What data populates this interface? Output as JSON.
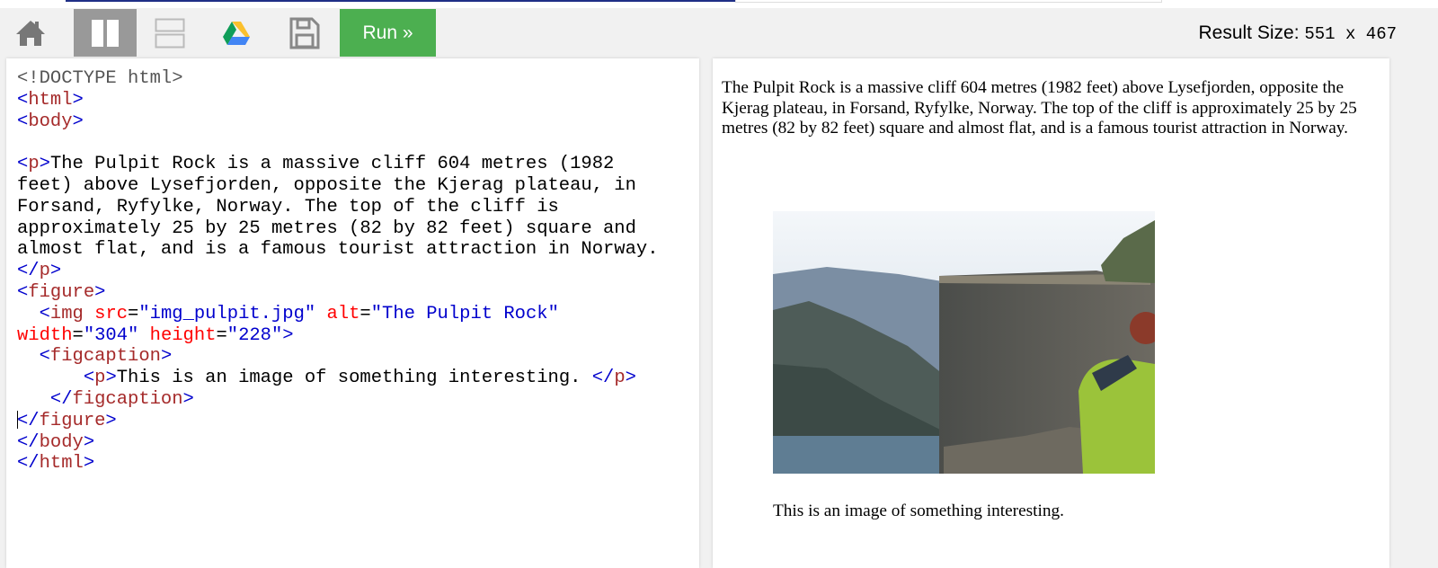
{
  "toolbar": {
    "icons": [
      "home-icon",
      "side-by-side-layout-icon",
      "stacked-layout-icon",
      "google-drive-icon",
      "save-icon"
    ],
    "run_label": "Run »",
    "result_size_label": "Result Size:",
    "result_size_value": "551 x 467"
  },
  "editor": {
    "lines": [
      [
        [
          "doc",
          "<!DOCTYPE html>"
        ]
      ],
      [
        [
          "br",
          "<"
        ],
        [
          "tag",
          "html"
        ],
        [
          "br",
          ">"
        ]
      ],
      [
        [
          "br",
          "<"
        ],
        [
          "tag",
          "body"
        ],
        [
          "br",
          ">"
        ]
      ],
      [],
      [
        [
          "br",
          "<"
        ],
        [
          "tag",
          "p"
        ],
        [
          "br",
          ">"
        ],
        [
          "txt",
          "The Pulpit Rock is a massive cliff 604 metres (1982"
        ]
      ],
      [
        [
          "txt",
          "feet) above Lysefjorden, opposite the Kjerag plateau, in"
        ]
      ],
      [
        [
          "txt",
          "Forsand, Ryfylke, Norway. The top of the cliff is"
        ]
      ],
      [
        [
          "txt",
          "approximately 25 by 25 metres (82 by 82 feet) square and"
        ]
      ],
      [
        [
          "txt",
          "almost flat, and is a famous tourist attraction in Norway."
        ]
      ],
      [
        [
          "br",
          "</"
        ],
        [
          "tag",
          "p"
        ],
        [
          "br",
          ">"
        ]
      ],
      [
        [
          "br",
          "<"
        ],
        [
          "tag",
          "figure"
        ],
        [
          "br",
          ">"
        ]
      ],
      [
        [
          "txt",
          "  "
        ],
        [
          "br",
          "<"
        ],
        [
          "tag",
          "img"
        ],
        [
          "txt",
          " "
        ],
        [
          "attr",
          "src"
        ],
        [
          "txt",
          "="
        ],
        [
          "val",
          "\"img_pulpit.jpg\""
        ],
        [
          "txt",
          " "
        ],
        [
          "attr",
          "alt"
        ],
        [
          "txt",
          "="
        ],
        [
          "val",
          "\"The Pulpit Rock\""
        ]
      ],
      [
        [
          "attr",
          "width"
        ],
        [
          "txt",
          "="
        ],
        [
          "val",
          "\"304\""
        ],
        [
          "txt",
          " "
        ],
        [
          "attr",
          "height"
        ],
        [
          "txt",
          "="
        ],
        [
          "val",
          "\"228\""
        ],
        [
          "br",
          ">"
        ]
      ],
      [
        [
          "txt",
          "  "
        ],
        [
          "br",
          "<"
        ],
        [
          "tag",
          "figcaption"
        ],
        [
          "br",
          ">"
        ]
      ],
      [
        [
          "txt",
          "      "
        ],
        [
          "br",
          "<"
        ],
        [
          "tag",
          "p"
        ],
        [
          "br",
          ">"
        ],
        [
          "txt",
          "This is an image of something interesting. "
        ],
        [
          "br",
          "</"
        ],
        [
          "tag",
          "p"
        ],
        [
          "br",
          ">"
        ]
      ],
      [
        [
          "txt",
          "   "
        ],
        [
          "br",
          "</"
        ],
        [
          "tag",
          "figcaption"
        ],
        [
          "br",
          ">"
        ]
      ],
      [
        [
          "cursor",
          ""
        ],
        [
          "br",
          "</"
        ],
        [
          "tag",
          "figure"
        ],
        [
          "br",
          ">"
        ]
      ],
      [
        [
          "br",
          "</"
        ],
        [
          "tag",
          "body"
        ],
        [
          "br",
          ">"
        ]
      ],
      [
        [
          "br",
          "</"
        ],
        [
          "tag",
          "html"
        ],
        [
          "br",
          ">"
        ]
      ]
    ]
  },
  "result": {
    "paragraph": "The Pulpit Rock is a massive cliff 604 metres (1982 feet) above Lysefjorden, opposite the Kjerag plateau, in Forsand, Ryfylke, Norway. The top of the cliff is approximately 25 by 25 metres (82 by 82 feet) square and almost flat, and is a famous tourist attraction in Norway.",
    "image_alt": "The Pulpit Rock",
    "caption": "This is an image of something interesting."
  }
}
